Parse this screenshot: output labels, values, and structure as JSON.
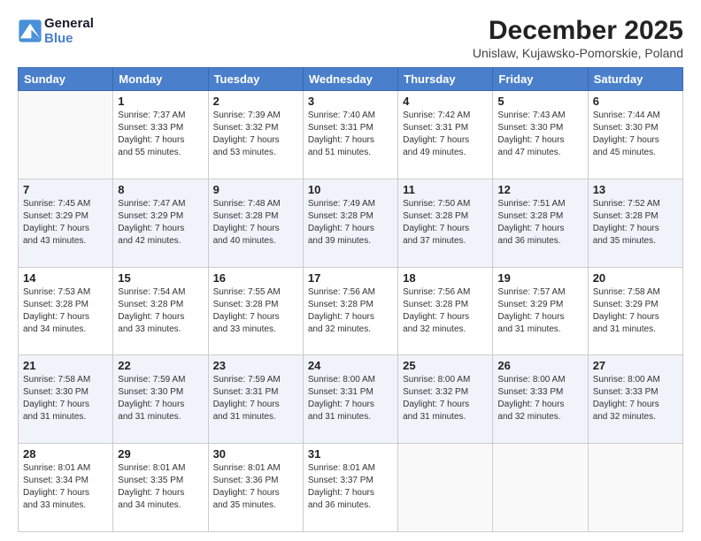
{
  "header": {
    "logo_line1": "General",
    "logo_line2": "Blue",
    "month": "December 2025",
    "location": "Unislaw, Kujawsko-Pomorskie, Poland"
  },
  "days_of_week": [
    "Sunday",
    "Monday",
    "Tuesday",
    "Wednesday",
    "Thursday",
    "Friday",
    "Saturday"
  ],
  "weeks": [
    [
      {
        "day": "",
        "info": ""
      },
      {
        "day": "1",
        "info": "Sunrise: 7:37 AM\nSunset: 3:33 PM\nDaylight: 7 hours\nand 55 minutes."
      },
      {
        "day": "2",
        "info": "Sunrise: 7:39 AM\nSunset: 3:32 PM\nDaylight: 7 hours\nand 53 minutes."
      },
      {
        "day": "3",
        "info": "Sunrise: 7:40 AM\nSunset: 3:31 PM\nDaylight: 7 hours\nand 51 minutes."
      },
      {
        "day": "4",
        "info": "Sunrise: 7:42 AM\nSunset: 3:31 PM\nDaylight: 7 hours\nand 49 minutes."
      },
      {
        "day": "5",
        "info": "Sunrise: 7:43 AM\nSunset: 3:30 PM\nDaylight: 7 hours\nand 47 minutes."
      },
      {
        "day": "6",
        "info": "Sunrise: 7:44 AM\nSunset: 3:30 PM\nDaylight: 7 hours\nand 45 minutes."
      }
    ],
    [
      {
        "day": "7",
        "info": "Sunrise: 7:45 AM\nSunset: 3:29 PM\nDaylight: 7 hours\nand 43 minutes."
      },
      {
        "day": "8",
        "info": "Sunrise: 7:47 AM\nSunset: 3:29 PM\nDaylight: 7 hours\nand 42 minutes."
      },
      {
        "day": "9",
        "info": "Sunrise: 7:48 AM\nSunset: 3:28 PM\nDaylight: 7 hours\nand 40 minutes."
      },
      {
        "day": "10",
        "info": "Sunrise: 7:49 AM\nSunset: 3:28 PM\nDaylight: 7 hours\nand 39 minutes."
      },
      {
        "day": "11",
        "info": "Sunrise: 7:50 AM\nSunset: 3:28 PM\nDaylight: 7 hours\nand 37 minutes."
      },
      {
        "day": "12",
        "info": "Sunrise: 7:51 AM\nSunset: 3:28 PM\nDaylight: 7 hours\nand 36 minutes."
      },
      {
        "day": "13",
        "info": "Sunrise: 7:52 AM\nSunset: 3:28 PM\nDaylight: 7 hours\nand 35 minutes."
      }
    ],
    [
      {
        "day": "14",
        "info": "Sunrise: 7:53 AM\nSunset: 3:28 PM\nDaylight: 7 hours\nand 34 minutes."
      },
      {
        "day": "15",
        "info": "Sunrise: 7:54 AM\nSunset: 3:28 PM\nDaylight: 7 hours\nand 33 minutes."
      },
      {
        "day": "16",
        "info": "Sunrise: 7:55 AM\nSunset: 3:28 PM\nDaylight: 7 hours\nand 33 minutes."
      },
      {
        "day": "17",
        "info": "Sunrise: 7:56 AM\nSunset: 3:28 PM\nDaylight: 7 hours\nand 32 minutes."
      },
      {
        "day": "18",
        "info": "Sunrise: 7:56 AM\nSunset: 3:28 PM\nDaylight: 7 hours\nand 32 minutes."
      },
      {
        "day": "19",
        "info": "Sunrise: 7:57 AM\nSunset: 3:29 PM\nDaylight: 7 hours\nand 31 minutes."
      },
      {
        "day": "20",
        "info": "Sunrise: 7:58 AM\nSunset: 3:29 PM\nDaylight: 7 hours\nand 31 minutes."
      }
    ],
    [
      {
        "day": "21",
        "info": "Sunrise: 7:58 AM\nSunset: 3:30 PM\nDaylight: 7 hours\nand 31 minutes."
      },
      {
        "day": "22",
        "info": "Sunrise: 7:59 AM\nSunset: 3:30 PM\nDaylight: 7 hours\nand 31 minutes."
      },
      {
        "day": "23",
        "info": "Sunrise: 7:59 AM\nSunset: 3:31 PM\nDaylight: 7 hours\nand 31 minutes."
      },
      {
        "day": "24",
        "info": "Sunrise: 8:00 AM\nSunset: 3:31 PM\nDaylight: 7 hours\nand 31 minutes."
      },
      {
        "day": "25",
        "info": "Sunrise: 8:00 AM\nSunset: 3:32 PM\nDaylight: 7 hours\nand 31 minutes."
      },
      {
        "day": "26",
        "info": "Sunrise: 8:00 AM\nSunset: 3:33 PM\nDaylight: 7 hours\nand 32 minutes."
      },
      {
        "day": "27",
        "info": "Sunrise: 8:00 AM\nSunset: 3:33 PM\nDaylight: 7 hours\nand 32 minutes."
      }
    ],
    [
      {
        "day": "28",
        "info": "Sunrise: 8:01 AM\nSunset: 3:34 PM\nDaylight: 7 hours\nand 33 minutes."
      },
      {
        "day": "29",
        "info": "Sunrise: 8:01 AM\nSunset: 3:35 PM\nDaylight: 7 hours\nand 34 minutes."
      },
      {
        "day": "30",
        "info": "Sunrise: 8:01 AM\nSunset: 3:36 PM\nDaylight: 7 hours\nand 35 minutes."
      },
      {
        "day": "31",
        "info": "Sunrise: 8:01 AM\nSunset: 3:37 PM\nDaylight: 7 hours\nand 36 minutes."
      },
      {
        "day": "",
        "info": ""
      },
      {
        "day": "",
        "info": ""
      },
      {
        "day": "",
        "info": ""
      }
    ]
  ]
}
